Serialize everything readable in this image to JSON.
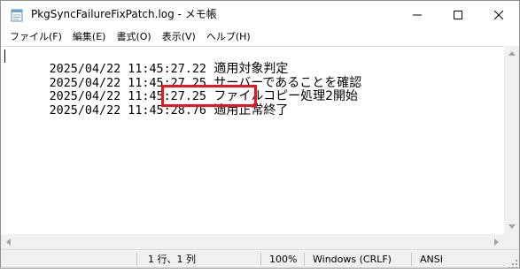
{
  "window": {
    "title": "PkgSyncFailureFixPatch.log - メモ帳"
  },
  "menu": {
    "items": [
      {
        "label": "ファイル(F)"
      },
      {
        "label": "編集(E)"
      },
      {
        "label": "書式(O)"
      },
      {
        "label": "表示(V)"
      },
      {
        "label": "ヘルプ(H)"
      }
    ]
  },
  "editor": {
    "lines": [
      {
        "timestamp": "2025/04/22 11:45:27.22",
        "message": "適用対象判定"
      },
      {
        "timestamp": "2025/04/22 11:45:27.25",
        "message": "サーバーであることを確認"
      },
      {
        "timestamp": "2025/04/22 11:45:27.25",
        "message": "ファイルコピー処理2開始"
      },
      {
        "timestamp": "2025/04/22 11:45:28.76",
        "message": "適用正常終了"
      }
    ],
    "highlight_color": "#e8161d"
  },
  "status": {
    "position": "1 行、1 列",
    "zoom": "100%",
    "line_ending": "Windows (CRLF)",
    "encoding": "ANSI"
  },
  "icons": {
    "app": "notepad-icon",
    "minimize": "minimize-icon",
    "maximize": "maximize-icon",
    "close": "close-icon"
  }
}
